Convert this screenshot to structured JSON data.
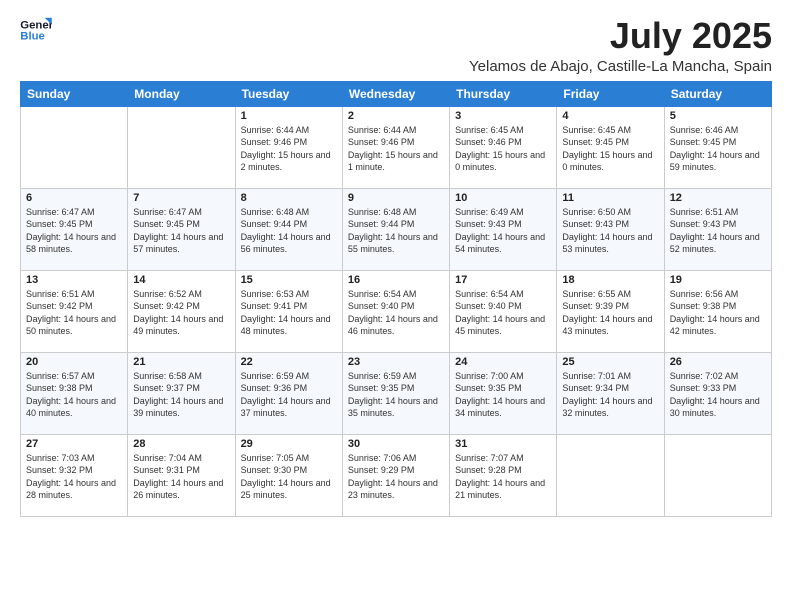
{
  "header": {
    "logo_line1": "General",
    "logo_line2": "Blue",
    "month": "July 2025",
    "location": "Yelamos de Abajo, Castille-La Mancha, Spain"
  },
  "days_of_week": [
    "Sunday",
    "Monday",
    "Tuesday",
    "Wednesday",
    "Thursday",
    "Friday",
    "Saturday"
  ],
  "weeks": [
    [
      {
        "day": "",
        "info": ""
      },
      {
        "day": "",
        "info": ""
      },
      {
        "day": "1",
        "info": "Sunrise: 6:44 AM\nSunset: 9:46 PM\nDaylight: 15 hours and 2 minutes."
      },
      {
        "day": "2",
        "info": "Sunrise: 6:44 AM\nSunset: 9:46 PM\nDaylight: 15 hours and 1 minute."
      },
      {
        "day": "3",
        "info": "Sunrise: 6:45 AM\nSunset: 9:46 PM\nDaylight: 15 hours and 0 minutes."
      },
      {
        "day": "4",
        "info": "Sunrise: 6:45 AM\nSunset: 9:45 PM\nDaylight: 15 hours and 0 minutes."
      },
      {
        "day": "5",
        "info": "Sunrise: 6:46 AM\nSunset: 9:45 PM\nDaylight: 14 hours and 59 minutes."
      }
    ],
    [
      {
        "day": "6",
        "info": "Sunrise: 6:47 AM\nSunset: 9:45 PM\nDaylight: 14 hours and 58 minutes."
      },
      {
        "day": "7",
        "info": "Sunrise: 6:47 AM\nSunset: 9:45 PM\nDaylight: 14 hours and 57 minutes."
      },
      {
        "day": "8",
        "info": "Sunrise: 6:48 AM\nSunset: 9:44 PM\nDaylight: 14 hours and 56 minutes."
      },
      {
        "day": "9",
        "info": "Sunrise: 6:48 AM\nSunset: 9:44 PM\nDaylight: 14 hours and 55 minutes."
      },
      {
        "day": "10",
        "info": "Sunrise: 6:49 AM\nSunset: 9:43 PM\nDaylight: 14 hours and 54 minutes."
      },
      {
        "day": "11",
        "info": "Sunrise: 6:50 AM\nSunset: 9:43 PM\nDaylight: 14 hours and 53 minutes."
      },
      {
        "day": "12",
        "info": "Sunrise: 6:51 AM\nSunset: 9:43 PM\nDaylight: 14 hours and 52 minutes."
      }
    ],
    [
      {
        "day": "13",
        "info": "Sunrise: 6:51 AM\nSunset: 9:42 PM\nDaylight: 14 hours and 50 minutes."
      },
      {
        "day": "14",
        "info": "Sunrise: 6:52 AM\nSunset: 9:42 PM\nDaylight: 14 hours and 49 minutes."
      },
      {
        "day": "15",
        "info": "Sunrise: 6:53 AM\nSunset: 9:41 PM\nDaylight: 14 hours and 48 minutes."
      },
      {
        "day": "16",
        "info": "Sunrise: 6:54 AM\nSunset: 9:40 PM\nDaylight: 14 hours and 46 minutes."
      },
      {
        "day": "17",
        "info": "Sunrise: 6:54 AM\nSunset: 9:40 PM\nDaylight: 14 hours and 45 minutes."
      },
      {
        "day": "18",
        "info": "Sunrise: 6:55 AM\nSunset: 9:39 PM\nDaylight: 14 hours and 43 minutes."
      },
      {
        "day": "19",
        "info": "Sunrise: 6:56 AM\nSunset: 9:38 PM\nDaylight: 14 hours and 42 minutes."
      }
    ],
    [
      {
        "day": "20",
        "info": "Sunrise: 6:57 AM\nSunset: 9:38 PM\nDaylight: 14 hours and 40 minutes."
      },
      {
        "day": "21",
        "info": "Sunrise: 6:58 AM\nSunset: 9:37 PM\nDaylight: 14 hours and 39 minutes."
      },
      {
        "day": "22",
        "info": "Sunrise: 6:59 AM\nSunset: 9:36 PM\nDaylight: 14 hours and 37 minutes."
      },
      {
        "day": "23",
        "info": "Sunrise: 6:59 AM\nSunset: 9:35 PM\nDaylight: 14 hours and 35 minutes."
      },
      {
        "day": "24",
        "info": "Sunrise: 7:00 AM\nSunset: 9:35 PM\nDaylight: 14 hours and 34 minutes."
      },
      {
        "day": "25",
        "info": "Sunrise: 7:01 AM\nSunset: 9:34 PM\nDaylight: 14 hours and 32 minutes."
      },
      {
        "day": "26",
        "info": "Sunrise: 7:02 AM\nSunset: 9:33 PM\nDaylight: 14 hours and 30 minutes."
      }
    ],
    [
      {
        "day": "27",
        "info": "Sunrise: 7:03 AM\nSunset: 9:32 PM\nDaylight: 14 hours and 28 minutes."
      },
      {
        "day": "28",
        "info": "Sunrise: 7:04 AM\nSunset: 9:31 PM\nDaylight: 14 hours and 26 minutes."
      },
      {
        "day": "29",
        "info": "Sunrise: 7:05 AM\nSunset: 9:30 PM\nDaylight: 14 hours and 25 minutes."
      },
      {
        "day": "30",
        "info": "Sunrise: 7:06 AM\nSunset: 9:29 PM\nDaylight: 14 hours and 23 minutes."
      },
      {
        "day": "31",
        "info": "Sunrise: 7:07 AM\nSunset: 9:28 PM\nDaylight: 14 hours and 21 minutes."
      },
      {
        "day": "",
        "info": ""
      },
      {
        "day": "",
        "info": ""
      }
    ]
  ]
}
